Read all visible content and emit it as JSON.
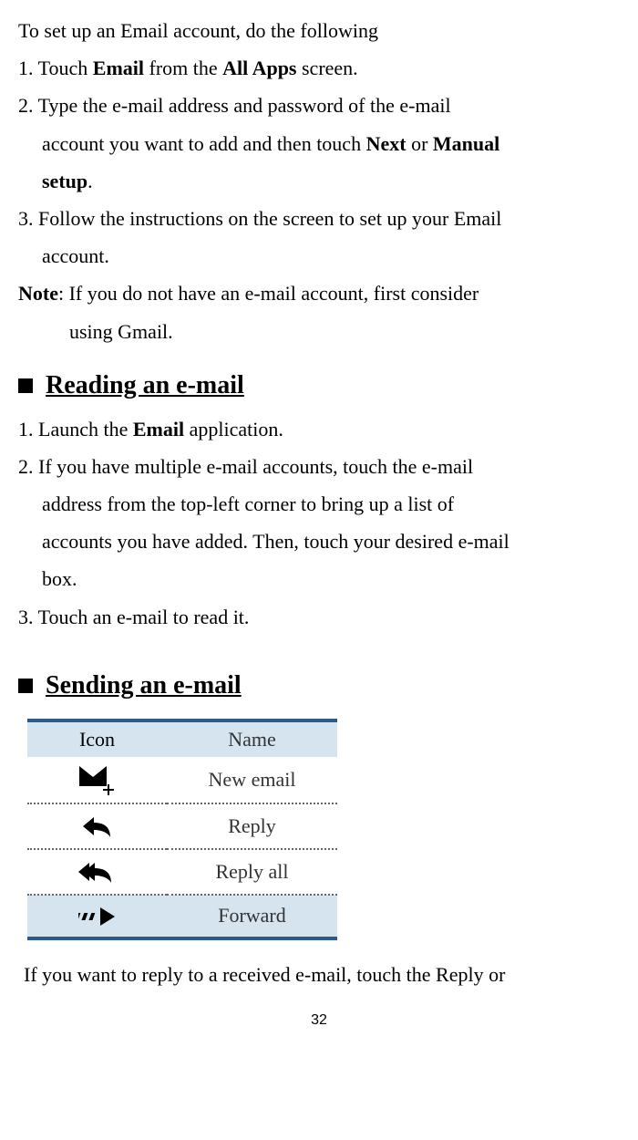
{
  "intro": "To set up an Email account, do the following",
  "step1": {
    "pre": "1. Touch ",
    "b1": "Email",
    "mid": " from the ",
    "b2": "All Apps",
    "post": " screen."
  },
  "step2_l1": "2. Type the e-mail address and password of the e-mail",
  "step2_l2": {
    "pre": "account you want to add and then touch ",
    "b1": "Next",
    "or": " or ",
    "b2": "Manual"
  },
  "step2_l3": "setup",
  "step2_l3_post": ".",
  "step3_l1": "3. Follow the instructions on the screen to set up your Email",
  "step3_l2": "account.",
  "note_l1": {
    "b": "Note",
    "post": ": If you do not have an e-mail account, first consider"
  },
  "note_l2": "using Gmail.",
  "heading_read": "Reading an e-mail",
  "read1": {
    "pre": "1. Launch the ",
    "b": "Email",
    "post": " application."
  },
  "read2_l1": "2. If you have multiple e-mail accounts, touch the e-mail",
  "read2_l2": "address from the top-left corner to bring up a list of",
  "read2_l3": "accounts you have added. Then, touch your desired e-mail",
  "read2_l4": "box.",
  "read3": "3. Touch an e-mail to read it.",
  "heading_send": "Sending an e-mail",
  "table": {
    "h_icon": "Icon",
    "h_name": "Name",
    "rows": [
      {
        "name": "New email"
      },
      {
        "name": "Reply"
      },
      {
        "name": "Reply all"
      },
      {
        "name": "Forward"
      }
    ]
  },
  "tail": "If you want to reply to a received e-mail, touch the Reply or",
  "page_num": "32"
}
